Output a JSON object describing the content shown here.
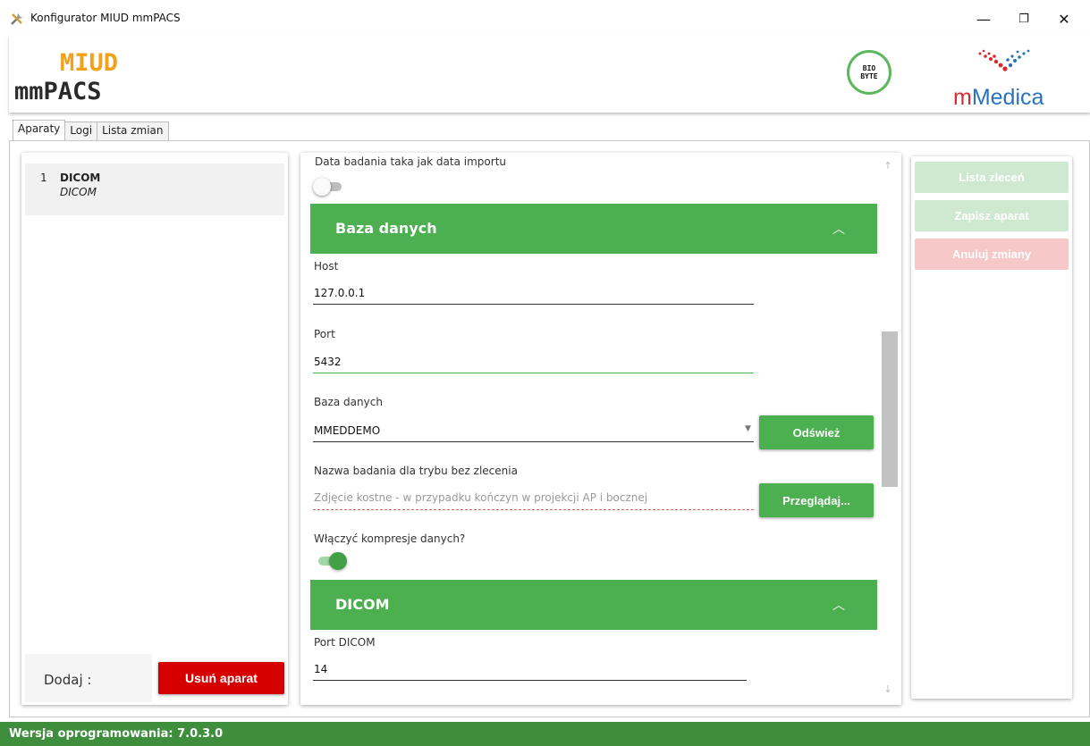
{
  "window": {
    "title": "Konfigurator MIUD mmPACS",
    "minimize": "—",
    "maximize": "❐",
    "close": "✕"
  },
  "logos": {
    "miud": "MIUD",
    "mmpacs": "mmPACS",
    "biobyte_top": "BIO",
    "biobyte_bottom": "BYTE",
    "mmedica_m": "m",
    "mmedica_rest": "Medica"
  },
  "tabs": [
    "Aparaty",
    "Logi",
    "Lista zmian"
  ],
  "devices": {
    "items": [
      {
        "num": "1",
        "name": "DICOM",
        "sub": "DICOM"
      }
    ],
    "add_label": "Dodaj :",
    "remove_label": "Usuń aparat"
  },
  "form": {
    "import_date_label": "Data badania taka jak data importu",
    "import_date_on": false,
    "db_section": "Baza danych",
    "host_label": "Host",
    "host_value": "127.0.0.1",
    "port_label": "Port",
    "port_value": "5432",
    "database_label": "Baza danych",
    "database_value": "MMEDDEMO",
    "refresh_label": "Odśwież",
    "exam_name_label": "Nazwa badania dla trybu bez zlecenia",
    "exam_name_placeholder": "Zdjęcie kostne - w przypadku kończyn w projekcji AP i bocznej",
    "browse_label": "Przeglądaj...",
    "compression_label": "Włączyć kompresje danych?",
    "compression_on": true,
    "dicom_section": "DICOM",
    "dicom_port_label": "Port DICOM",
    "dicom_port_value": "14"
  },
  "actions": {
    "orders": "Lista zleceń",
    "save": "Zapisz aparat",
    "cancel": "Anuluj zmiany"
  },
  "footer": {
    "version": "Wersja oprogramowania: 7.0.3.0"
  },
  "colors": {
    "accent_green": "#4caf50",
    "footer_green": "#3e8e3e",
    "danger_red": "#d60000",
    "miud_orange": "#f3a01b"
  }
}
